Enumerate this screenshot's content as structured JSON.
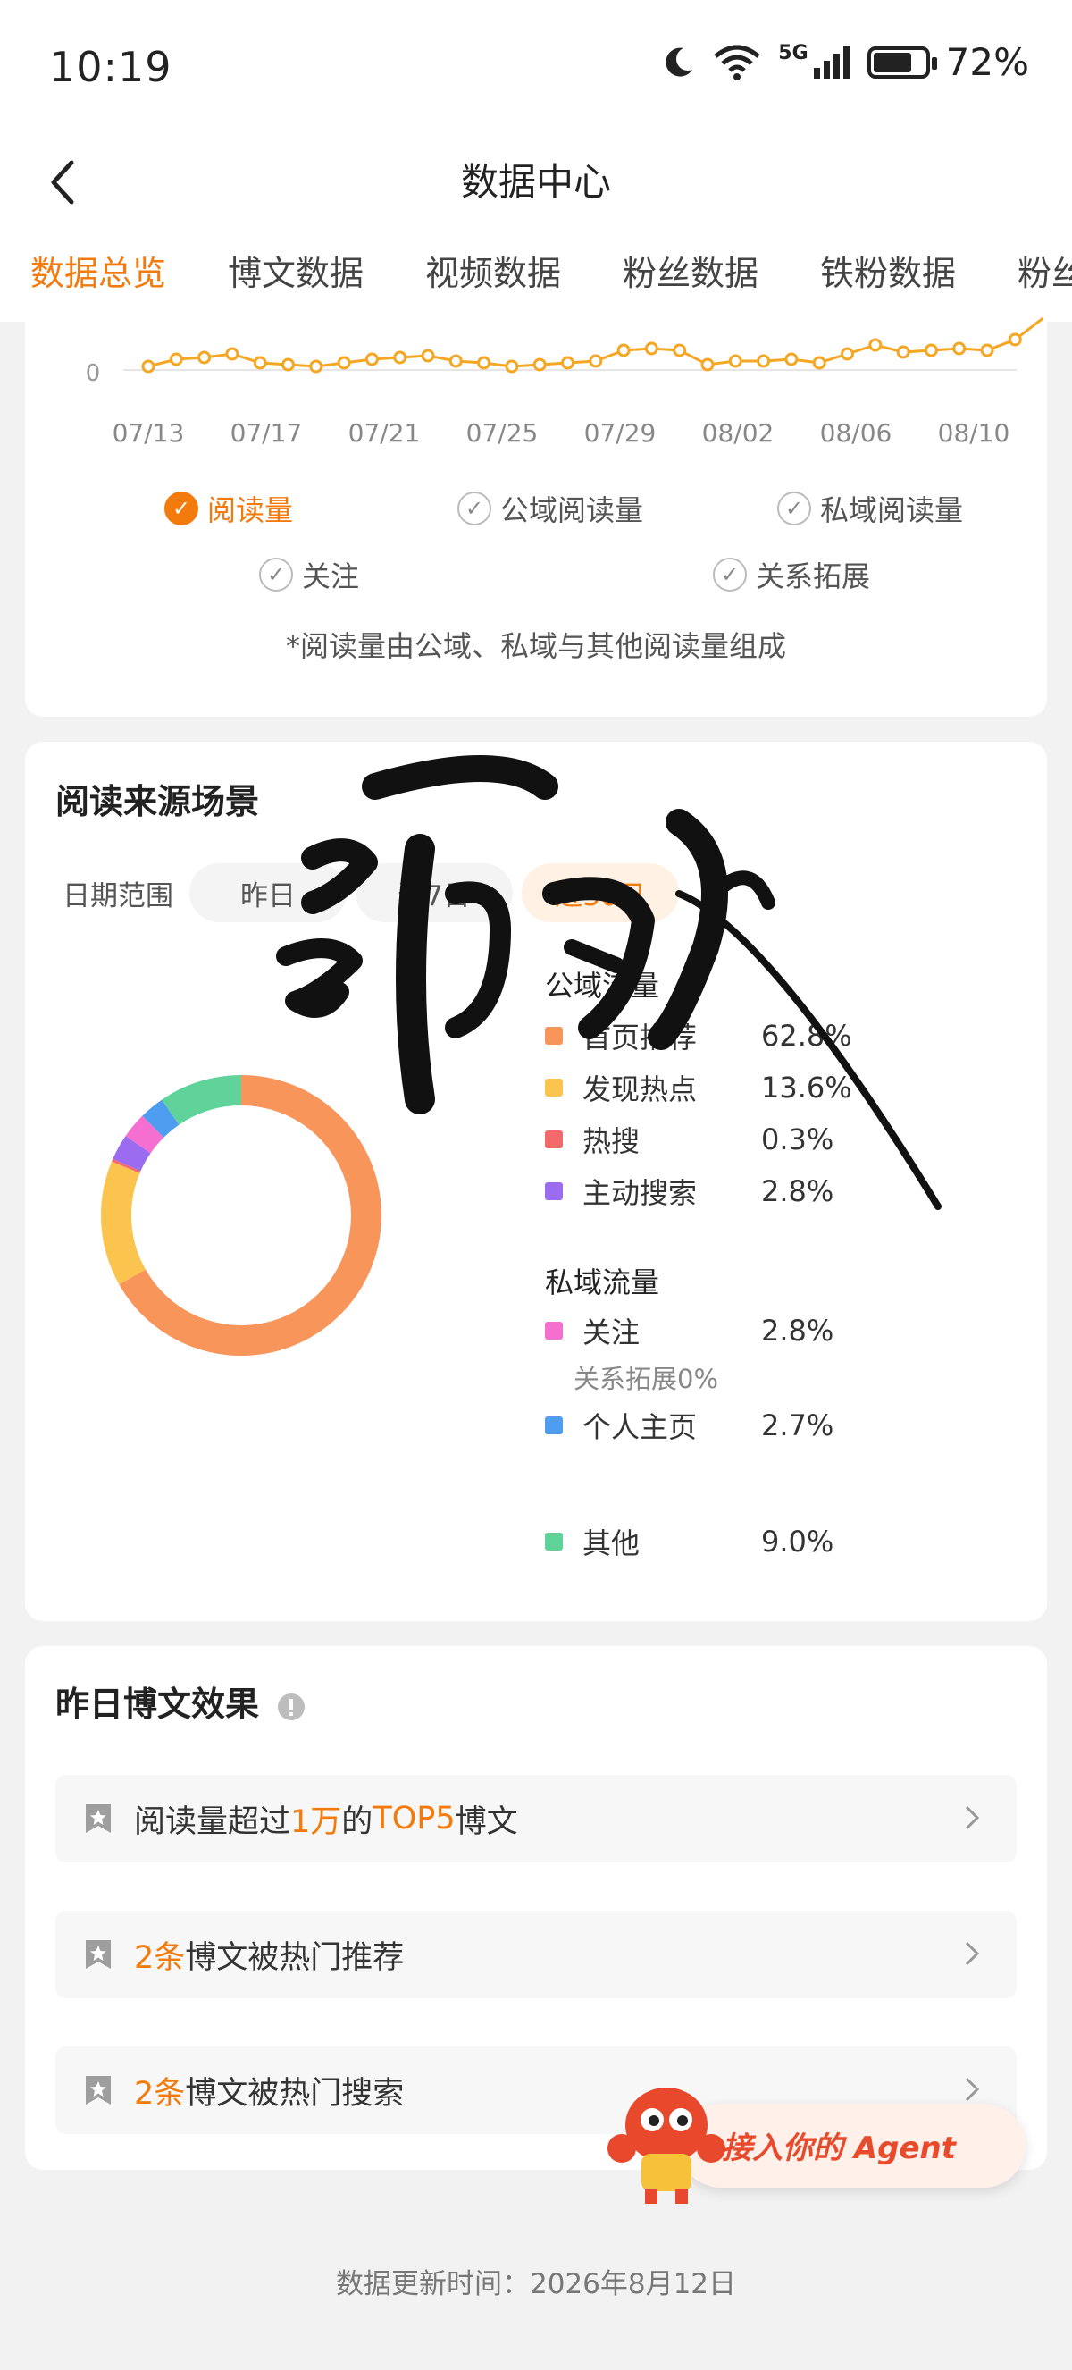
{
  "status": {
    "time": "10:19",
    "network": "5G",
    "battery_pct": "72%",
    "battery_level": 0.72
  },
  "nav": {
    "title": "数据中心"
  },
  "tabs": [
    "数据总览",
    "博文数据",
    "视频数据",
    "粉丝数据",
    "铁粉数据",
    "粉丝"
  ],
  "trend_chart": {
    "y_tick": "0",
    "x_ticks": [
      "07/13",
      "07/17",
      "07/21",
      "07/25",
      "07/29",
      "08/02",
      "08/06",
      "08/10"
    ],
    "toggles": [
      {
        "label": "阅读量",
        "checked": true
      },
      {
        "label": "公域阅读量",
        "checked": false
      },
      {
        "label": "私域阅读量",
        "checked": false
      },
      {
        "label": "关注",
        "checked": false
      },
      {
        "label": "关系拓展",
        "checked": false
      }
    ],
    "note": "*阅读量由公域、私域与其他阅读量组成",
    "line_color": "#f5a623"
  },
  "source": {
    "title": "阅读来源场景",
    "date_label": "日期范围",
    "date_options": [
      "昨日",
      "近7日",
      "近30日"
    ],
    "active_option": "近30日",
    "public_title": "公域流量",
    "private_title": "私域流量",
    "public": [
      {
        "name": "首页推荐",
        "value": "62.8%",
        "color": "#f8955a"
      },
      {
        "name": "发现热点",
        "value": "13.6%",
        "color": "#fbc44f"
      },
      {
        "name": "热搜",
        "value": "0.3%",
        "color": "#f46a6a"
      },
      {
        "name": "主动搜索",
        "value": "2.8%",
        "color": "#9b6cf0"
      }
    ],
    "private": [
      {
        "name": "关注",
        "value": "2.8%",
        "color": "#f46fd0"
      },
      {
        "name": "个人主页",
        "value": "2.7%",
        "color": "#4f9df0"
      }
    ],
    "relation_sub": "关系拓展0%",
    "other": {
      "name": "其他",
      "value": "9.0%",
      "color": "#5fd39a"
    },
    "stamp_text": "滑败"
  },
  "yesterday": {
    "title": "昨日博文效果",
    "rows": [
      {
        "pre": "阅读量超过",
        "hl1": "1万",
        "mid": "的",
        "hl2": "TOP5",
        "post": "博文"
      },
      {
        "hl1": "2条",
        "post": "博文被热门推荐"
      },
      {
        "hl1": "2条",
        "post": "博文被热门搜索"
      }
    ]
  },
  "agent_badge": "接入你的 Agent",
  "footer": {
    "update_time": "数据更新时间：2026年8月12日"
  }
}
